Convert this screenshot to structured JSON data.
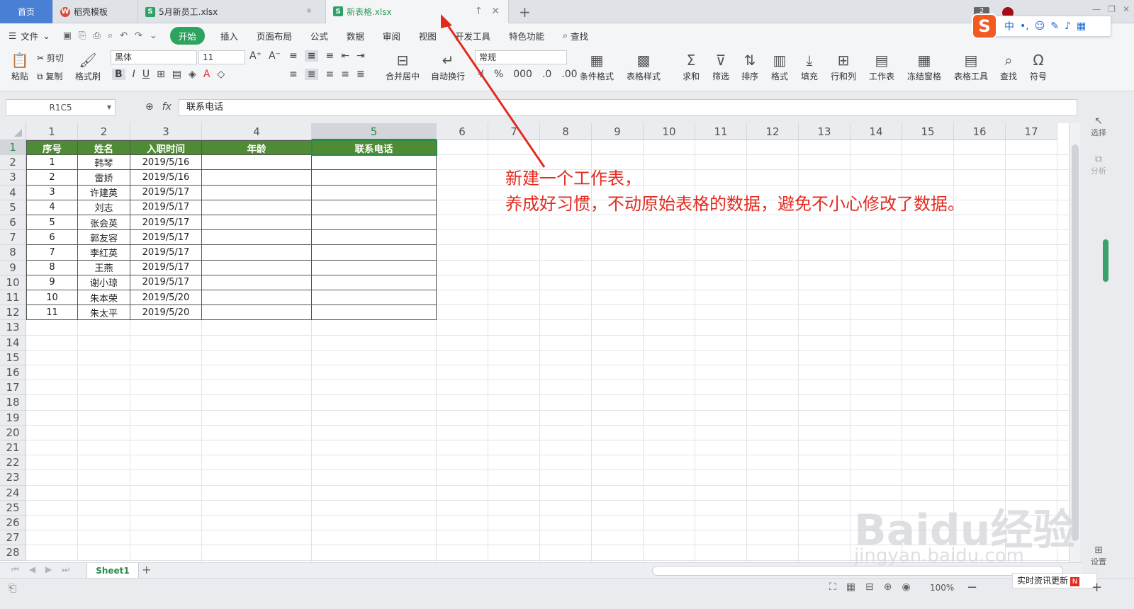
{
  "tabs": {
    "home": "首页",
    "items": [
      {
        "label": "稻壳模板",
        "icon": "wps-icon"
      },
      {
        "label": "5月新员工.xlsx",
        "icon": "sheet-icon"
      },
      {
        "label": "新表格.xlsx",
        "icon": "sheet-icon"
      }
    ]
  },
  "menu": {
    "file": "文件",
    "items": [
      "开始",
      "插入",
      "页面布局",
      "公式",
      "数据",
      "审阅",
      "视图",
      "开发工具",
      "特色功能"
    ],
    "active": "开始",
    "search": "查找"
  },
  "ribbon": {
    "paste": "粘贴",
    "cut": "剪切",
    "copy": "复制",
    "format_painter": "格式刷",
    "font_name": "黑体",
    "font_size": "11",
    "merge_center": "合并居中",
    "wrap": "自动换行",
    "number_format": "常规",
    "cond_format": "条件格式",
    "table_style": "表格样式",
    "sum": "求和",
    "filter": "筛选",
    "sort": "排序",
    "format": "格式",
    "fill": "填充",
    "rowcol": "行和列",
    "worksheet": "工作表",
    "freeze": "冻结窗格",
    "table_tools": "表格工具",
    "find": "查找",
    "symbol": "符号"
  },
  "ime": {
    "logo": "S",
    "mode": "中"
  },
  "formula": {
    "name_box": "R1C5",
    "value": "联系电话"
  },
  "grid": {
    "col_headers": [
      "1",
      "2",
      "3",
      "4",
      "5",
      "6",
      "7",
      "8",
      "9",
      "10",
      "11",
      "12",
      "13",
      "14",
      "15",
      "16",
      "17"
    ],
    "row_headers": [
      "1",
      "2",
      "3",
      "4",
      "5",
      "6",
      "7",
      "8",
      "9",
      "10",
      "11",
      "12",
      "13",
      "14",
      "15",
      "16",
      "17",
      "18",
      "19",
      "20",
      "21",
      "22",
      "23",
      "24",
      "25",
      "26",
      "27",
      "28"
    ],
    "selected_col": "5",
    "selected_row": "1",
    "header_row": [
      "序号",
      "姓名",
      "入职时间",
      "年龄",
      "联系电话"
    ],
    "rows": [
      [
        "1",
        "韩琴",
        "2019/5/16",
        "",
        ""
      ],
      [
        "2",
        "雷娇",
        "2019/5/16",
        "",
        ""
      ],
      [
        "3",
        "许建英",
        "2019/5/17",
        "",
        ""
      ],
      [
        "4",
        "刘志",
        "2019/5/17",
        "",
        ""
      ],
      [
        "5",
        "张会英",
        "2019/5/17",
        "",
        ""
      ],
      [
        "6",
        "郭友容",
        "2019/5/17",
        "",
        ""
      ],
      [
        "7",
        "李红英",
        "2019/5/17",
        "",
        ""
      ],
      [
        "8",
        "王燕",
        "2019/5/17",
        "",
        ""
      ],
      [
        "9",
        "谢小琼",
        "2019/5/17",
        "",
        ""
      ],
      [
        "10",
        "朱本荣",
        "2019/5/20",
        "",
        ""
      ],
      [
        "11",
        "朱太平",
        "2019/5/20",
        "",
        ""
      ]
    ]
  },
  "annotation": {
    "line1": "新建一个工作表，",
    "line2": "养成好习惯，不动原始表格的数据，避免不小心修改了数据。"
  },
  "sheets": {
    "active": "Sheet1"
  },
  "right_panel": {
    "select": "选择",
    "analyze": "分析",
    "settings": "设置"
  },
  "status": {
    "zoom": "100%",
    "news": "实时资讯更新",
    "news_badge": "N"
  },
  "watermark": {
    "brand": "Baidu经验",
    "url": "jingyan.baidu.com"
  },
  "colors": {
    "accent": "#2ca35f",
    "header_fill": "#4f8a34",
    "annotation": "#e32a1f",
    "home_tab": "#4a7fd6"
  }
}
